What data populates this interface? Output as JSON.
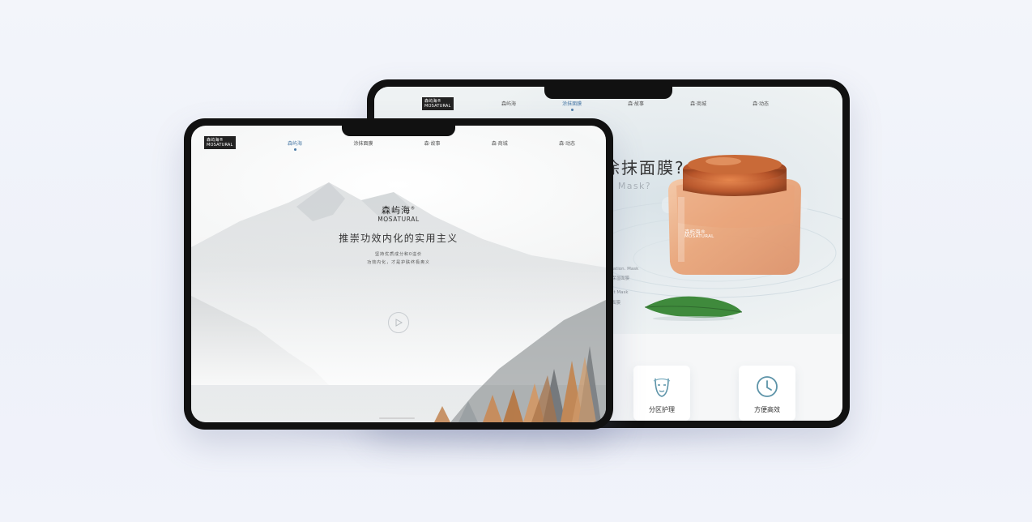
{
  "back_tablet": {
    "logo": {
      "line1": "森屿海®",
      "line2": "MOSATURAL"
    },
    "nav": [
      "森屿海",
      "涂抹面膜",
      "森·故事",
      "森·商城",
      "森·动态"
    ],
    "active_nav_index": 1,
    "heading_cn": "涂抹面膜?",
    "heading_en": "r Mask?",
    "side_lines": [
      "dration. Mask",
      "保湿面膜",
      "ht Mask",
      "面膜"
    ],
    "jar_label_cn": "森屿海®",
    "jar_label_en": "MOSATURAL",
    "features": [
      {
        "label": "分区护理",
        "icon": "face-icon"
      },
      {
        "label": "方便高效",
        "icon": "clock-icon"
      }
    ]
  },
  "front_tablet": {
    "logo": {
      "line1": "森屿海®",
      "line2": "MOSATURAL"
    },
    "nav": [
      "森屿海",
      "涂抹面膜",
      "森·故事",
      "森·商城",
      "森·动态"
    ],
    "active_nav_index": 0,
    "brand_cn": "森屿海",
    "brand_mark": "®",
    "brand_en": "MOSATURAL",
    "slogan": "推崇功效内化的实用主义",
    "sub_line1": "坚持优质成分和0溢价",
    "sub_line2": "功效内化，才是护肤终极奥义"
  },
  "colors": {
    "accent": "#4b7aa6",
    "frame": "#111111",
    "background": "#f1f3fa"
  }
}
